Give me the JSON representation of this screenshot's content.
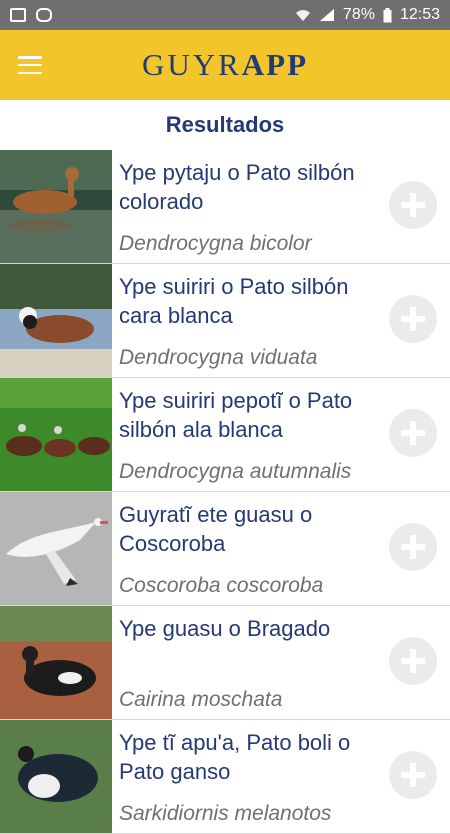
{
  "status": {
    "battery": "78%",
    "time": "12:53",
    "icons": [
      "image-notification-icon",
      "voicemail-icon",
      "wifi-icon",
      "signal-icon",
      "battery-icon"
    ]
  },
  "appbar": {
    "brand_part1": "GUYR",
    "brand_part2": "APP",
    "menu_icon": "hamburger-menu-icon",
    "colors": {
      "background": "#f2c52a",
      "brand": "#243a75"
    }
  },
  "section": {
    "title": "Resultados"
  },
  "results": [
    {
      "common": "Ype pytaju o Pato silbón colorado",
      "scientific": "Dendrocygna bicolor"
    },
    {
      "common": "Ype suiriri o Pato silbón cara blanca",
      "scientific": "Dendrocygna viduata"
    },
    {
      "common": "Ype suiriri pepotĩ o Pato silbón ala blanca",
      "scientific": "Dendrocygna autumnalis"
    },
    {
      "common": "Guyratĩ ete guasu o Coscoroba",
      "scientific": "Coscoroba coscoroba"
    },
    {
      "common": "Ype guasu o Bragado",
      "scientific": "Cairina moschata"
    },
    {
      "common": "Ype tĩ apu'a, Pato boli o Pato ganso",
      "scientific": "Sarkidiornis melanotos"
    }
  ]
}
